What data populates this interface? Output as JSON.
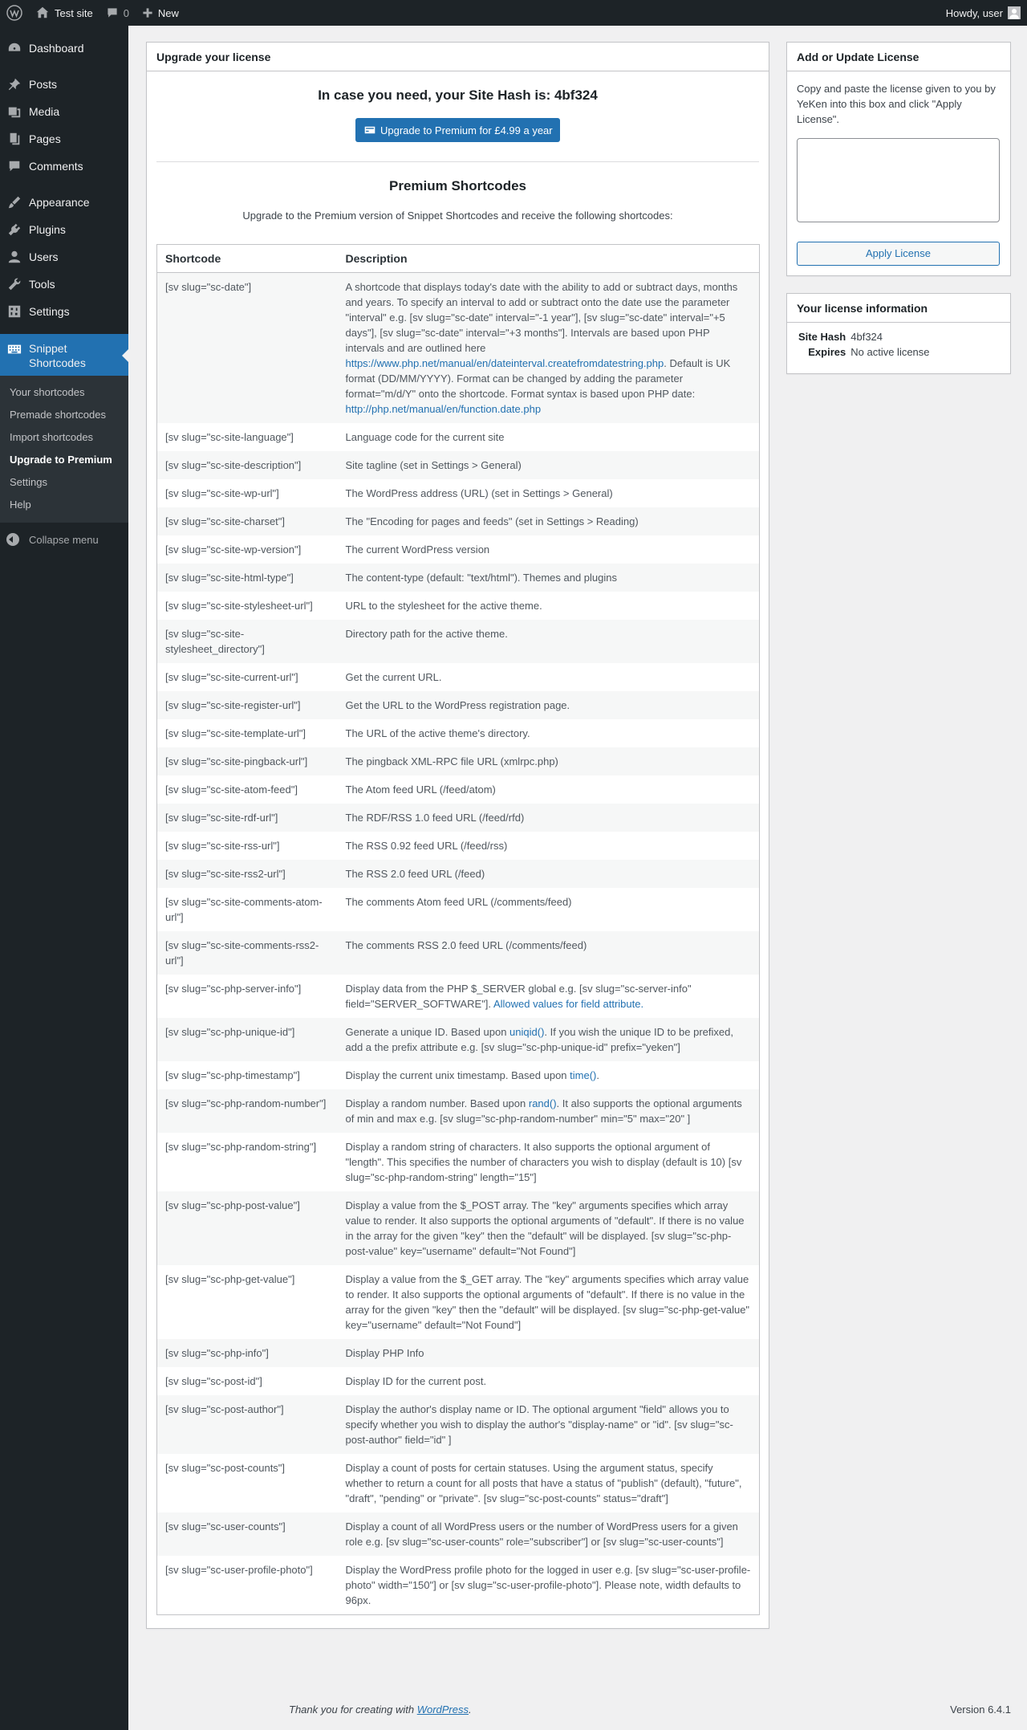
{
  "adminbar": {
    "site_name": "Test site",
    "comments_count": "0",
    "new_label": "New",
    "howdy": "Howdy, user"
  },
  "menu": {
    "items": [
      {
        "label": "Dashboard",
        "icon": "dashboard-icon"
      },
      {
        "label": "Posts",
        "icon": "pin-icon"
      },
      {
        "label": "Media",
        "icon": "media-icon"
      },
      {
        "label": "Pages",
        "icon": "pages-icon"
      },
      {
        "label": "Comments",
        "icon": "comment-icon"
      },
      {
        "label": "Appearance",
        "icon": "brush-icon"
      },
      {
        "label": "Plugins",
        "icon": "plug-icon"
      },
      {
        "label": "Users",
        "icon": "user-icon"
      },
      {
        "label": "Tools",
        "icon": "wrench-icon"
      },
      {
        "label": "Settings",
        "icon": "settings-icon"
      }
    ],
    "current": {
      "label_line1": "Snippet",
      "label_line2": "Shortcodes",
      "icon": "keyboard-icon"
    },
    "submenu": [
      "Your shortcodes",
      "Premade shortcodes",
      "Import shortcodes",
      "Upgrade to Premium",
      "Settings",
      "Help"
    ],
    "collapse": "Collapse menu"
  },
  "main": {
    "title": "Upgrade your license",
    "hash_heading": "In case you need, your Site Hash is: 4bf324",
    "upgrade_button": "Upgrade to Premium for £4.99 a year",
    "premium_title": "Premium Shortcodes",
    "premium_desc": "Upgrade to the Premium version of Snippet Shortcodes and receive the following shortcodes:",
    "table": {
      "headers": [
        "Shortcode",
        "Description"
      ],
      "rows": [
        {
          "code": "[sv slug=\"sc-date\"]",
          "desc": [
            {
              "t": "A shortcode that displays today's date with the ability to add or subtract days, months and years. To specify an interval to add or subtract onto the date use the parameter \"interval\" e.g. [sv slug=\"sc-date\" interval=\"-1 year\"], [sv slug=\"sc-date\" interval=\"+5 days\"], [sv slug=\"sc-date\" interval=\"+3 months\"]. Intervals are based upon PHP intervals and are outlined here "
            },
            {
              "t": "https://www.php.net/manual/en/dateinterval.createfromdatestring.php",
              "link": true
            },
            {
              "t": ". Default is UK format (DD/MM/YYYY). Format can be changed by adding the parameter format=\"m/d/Y\" onto the shortcode. Format syntax is based upon PHP date: "
            },
            {
              "t": "http://php.net/manual/en/function.date.php",
              "link": true
            }
          ]
        },
        {
          "code": "[sv slug=\"sc-site-language\"]",
          "desc": [
            {
              "t": "Language code for the current site"
            }
          ]
        },
        {
          "code": "[sv slug=\"sc-site-description\"]",
          "desc": [
            {
              "t": "Site tagline (set in Settings > General)"
            }
          ]
        },
        {
          "code": "[sv slug=\"sc-site-wp-url\"]",
          "desc": [
            {
              "t": "The WordPress address (URL) (set in Settings > General)"
            }
          ]
        },
        {
          "code": "[sv slug=\"sc-site-charset\"]",
          "desc": [
            {
              "t": "The \"Encoding for pages and feeds\" (set in Settings > Reading)"
            }
          ]
        },
        {
          "code": "[sv slug=\"sc-site-wp-version\"]",
          "desc": [
            {
              "t": "The current WordPress version"
            }
          ]
        },
        {
          "code": "[sv slug=\"sc-site-html-type\"]",
          "desc": [
            {
              "t": "The content-type (default: \"text/html\"). Themes and plugins"
            }
          ]
        },
        {
          "code": "[sv slug=\"sc-site-stylesheet-url\"]",
          "desc": [
            {
              "t": "URL to the stylesheet for the active theme."
            }
          ]
        },
        {
          "code": "[sv slug=\"sc-site-stylesheet_directory\"]",
          "desc": [
            {
              "t": "Directory path for the active theme."
            }
          ]
        },
        {
          "code": "[sv slug=\"sc-site-current-url\"]",
          "desc": [
            {
              "t": "Get the current URL."
            }
          ]
        },
        {
          "code": "[sv slug=\"sc-site-register-url\"]",
          "desc": [
            {
              "t": "Get the URL to the WordPress registration page."
            }
          ]
        },
        {
          "code": "[sv slug=\"sc-site-template-url\"]",
          "desc": [
            {
              "t": "The URL of the active theme's directory."
            }
          ]
        },
        {
          "code": "[sv slug=\"sc-site-pingback-url\"]",
          "desc": [
            {
              "t": "The pingback XML-RPC file URL (xmlrpc.php)"
            }
          ]
        },
        {
          "code": "[sv slug=\"sc-site-atom-feed\"]",
          "desc": [
            {
              "t": "The Atom feed URL (/feed/atom)"
            }
          ]
        },
        {
          "code": "[sv slug=\"sc-site-rdf-url\"]",
          "desc": [
            {
              "t": "The RDF/RSS 1.0 feed URL (/feed/rfd)"
            }
          ]
        },
        {
          "code": "[sv slug=\"sc-site-rss-url\"]",
          "desc": [
            {
              "t": "The RSS 0.92 feed URL (/feed/rss)"
            }
          ]
        },
        {
          "code": "[sv slug=\"sc-site-rss2-url\"]",
          "desc": [
            {
              "t": "The RSS 2.0 feed URL (/feed)"
            }
          ]
        },
        {
          "code": "[sv slug=\"sc-site-comments-atom-url\"]",
          "desc": [
            {
              "t": "The comments Atom feed URL (/comments/feed)"
            }
          ]
        },
        {
          "code": "[sv slug=\"sc-site-comments-rss2-url\"]",
          "desc": [
            {
              "t": "The comments RSS 2.0 feed URL (/comments/feed)"
            }
          ]
        },
        {
          "code": "[sv slug=\"sc-php-server-info\"]",
          "desc": [
            {
              "t": "Display data from the PHP $_SERVER global e.g. [sv slug=\"sc-server-info\" field=\"SERVER_SOFTWARE\"]. "
            },
            {
              "t": "Allowed values for field attribute.",
              "link": true
            }
          ]
        },
        {
          "code": "[sv slug=\"sc-php-unique-id\"]",
          "desc": [
            {
              "t": "Generate a unique ID. Based upon "
            },
            {
              "t": "uniqid()",
              "link": true
            },
            {
              "t": ". If you wish the unique ID to be prefixed, add a the prefix attribute e.g. [sv slug=\"sc-php-unique-id\" prefix=\"yeken\"]"
            }
          ]
        },
        {
          "code": "[sv slug=\"sc-php-timestamp\"]",
          "desc": [
            {
              "t": "Display the current unix timestamp. Based upon "
            },
            {
              "t": "time()",
              "link": true
            },
            {
              "t": "."
            }
          ]
        },
        {
          "code": "[sv slug=\"sc-php-random-number\"]",
          "desc": [
            {
              "t": "Display a random number. Based upon "
            },
            {
              "t": "rand()",
              "link": true
            },
            {
              "t": ". It also supports the optional arguments of min and max e.g. [sv slug=\"sc-php-random-number\" min=\"5\" max=\"20\" ]"
            }
          ]
        },
        {
          "code": "[sv slug=\"sc-php-random-string\"]",
          "desc": [
            {
              "t": "Display a random string of characters. It also supports the optional argument of \"length\". This specifies the number of characters you wish to display (default is 10) [sv slug=\"sc-php-random-string\" length=\"15\"]"
            }
          ]
        },
        {
          "code": "[sv slug=\"sc-php-post-value\"]",
          "desc": [
            {
              "t": "Display a value from the $_POST array. The \"key\" arguments specifies which array value to render. It also supports the optional arguments of \"default\". If there is no value in the array for the given \"key\" then the \"default\" will be displayed. [sv slug=\"sc-php-post-value\" key=\"username\" default=\"Not Found\"]"
            }
          ]
        },
        {
          "code": "[sv slug=\"sc-php-get-value\"]",
          "desc": [
            {
              "t": "Display a value from the $_GET array. The \"key\" arguments specifies which array value to render. It also supports the optional arguments of \"default\". If there is no value in the array for the given \"key\" then the \"default\" will be displayed. [sv slug=\"sc-php-get-value\" key=\"username\" default=\"Not Found\"]"
            }
          ]
        },
        {
          "code": "[sv slug=\"sc-php-info\"]",
          "desc": [
            {
              "t": "Display PHP Info"
            }
          ]
        },
        {
          "code": "[sv slug=\"sc-post-id\"]",
          "desc": [
            {
              "t": "Display ID for the current post."
            }
          ]
        },
        {
          "code": "[sv slug=\"sc-post-author\"]",
          "desc": [
            {
              "t": "Display the author's display name or ID. The optional argument \"field\" allows you to specify whether you wish to display the author's \"display-name\" or \"id\". [sv slug=\"sc-post-author\" field=\"id\" ]"
            }
          ]
        },
        {
          "code": "[sv slug=\"sc-post-counts\"]",
          "desc": [
            {
              "t": "Display a count of posts for certain statuses. Using the argument status, specify whether to return a count for all posts that have a status of \"publish\" (default), \"future\", \"draft\", \"pending\" or \"private\". [sv slug=\"sc-post-counts\" status=\"draft\"]"
            }
          ]
        },
        {
          "code": "[sv slug=\"sc-user-counts\"]",
          "desc": [
            {
              "t": "Display a count of all WordPress users or the number of WordPress users for a given role e.g. [sv slug=\"sc-user-counts\" role=\"subscriber\"] or [sv slug=\"sc-user-counts\"]"
            }
          ]
        },
        {
          "code": "[sv slug=\"sc-user-profile-photo\"]",
          "desc": [
            {
              "t": "Display the WordPress profile photo for the logged in user e.g. [sv slug=\"sc-user-profile-photo\" width=\"150\"] or [sv slug=\"sc-user-profile-photo\"]. Please note, width defaults to 96px."
            }
          ]
        }
      ]
    }
  },
  "license": {
    "title": "Add or Update License",
    "instructions": "Copy and paste the license given to you by YeKen into this box and click \"Apply License\".",
    "textarea_value": "",
    "apply_button": "Apply License"
  },
  "info": {
    "title": "Your license information",
    "site_hash_label": "Site Hash",
    "site_hash_value": "4bf324",
    "expires_label": "Expires",
    "expires_value": "No active license"
  },
  "footer": {
    "thanks_prefix": "Thank you for creating with ",
    "thanks_link": "WordPress",
    "thanks_suffix": ".",
    "version": "Version 6.4.1"
  },
  "colors": {
    "accent": "#2271b1",
    "adminbar_bg": "#1d2327",
    "background": "#f0f0f1"
  }
}
